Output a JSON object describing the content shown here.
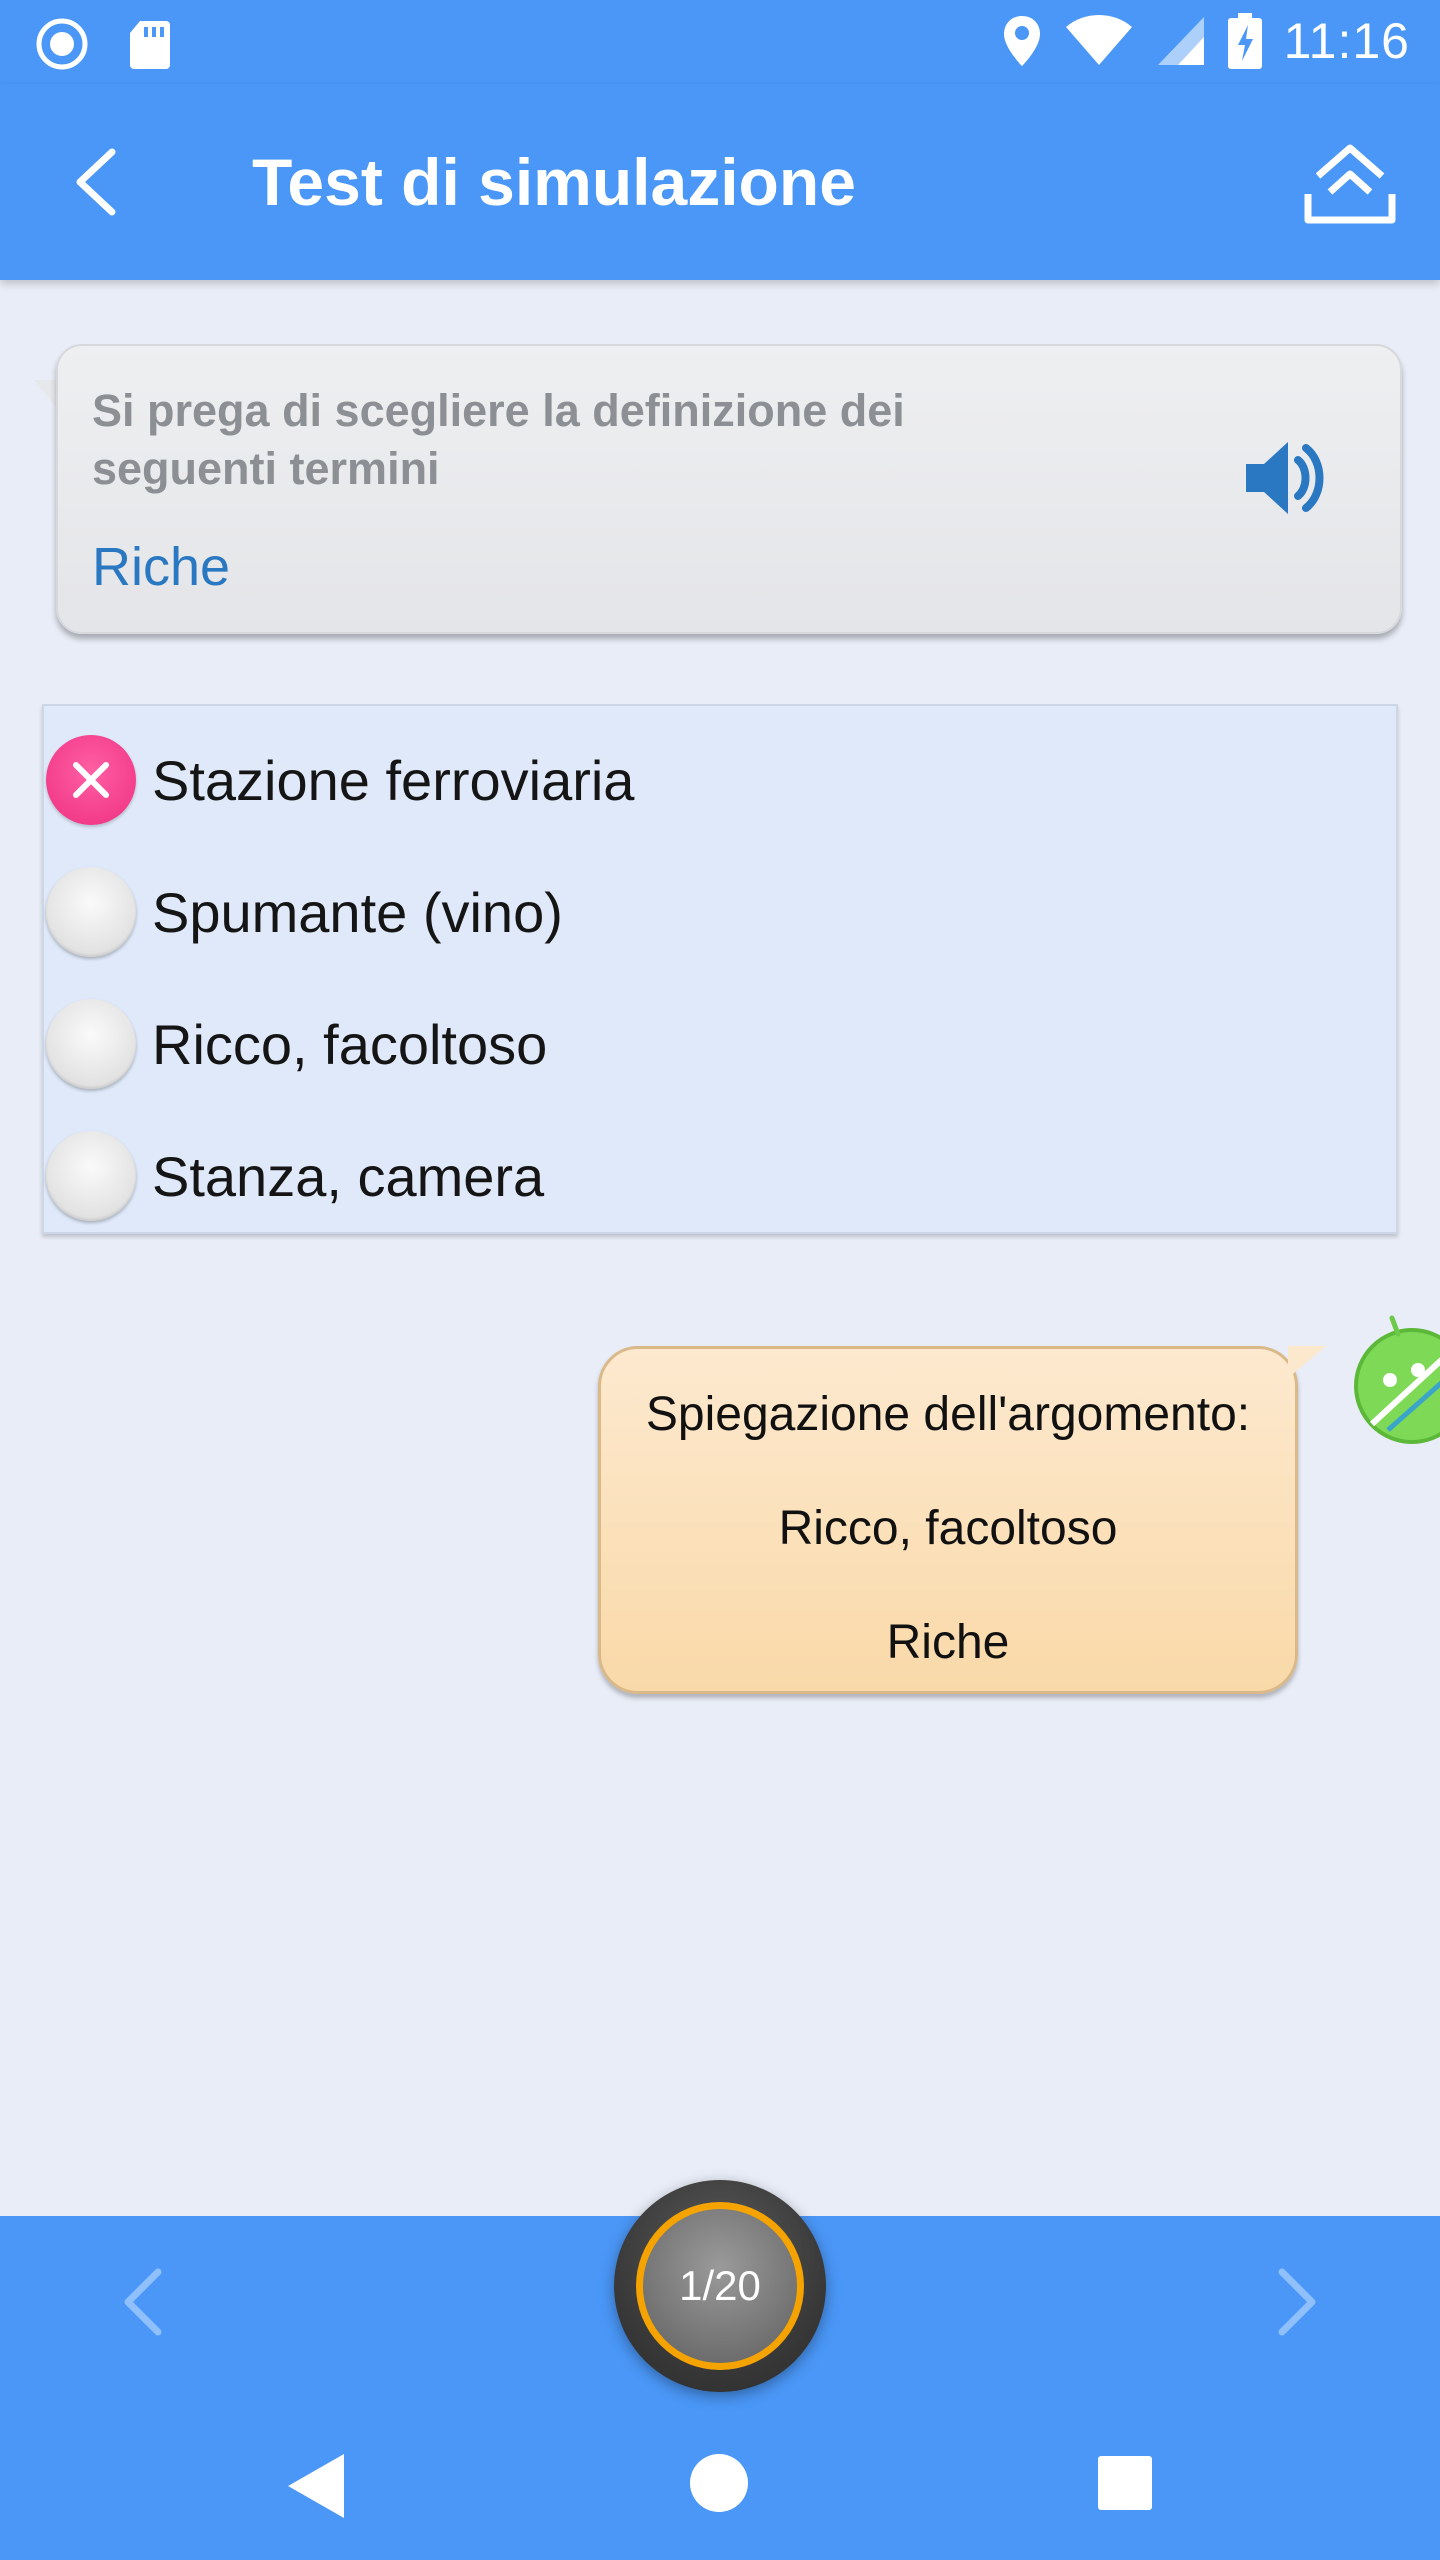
{
  "status_bar": {
    "time": "11:16",
    "icons": [
      "record-icon",
      "sd-card-icon",
      "location-icon",
      "wifi-icon",
      "signal-icon",
      "battery-icon"
    ]
  },
  "app_bar": {
    "title": "Test di simulazione"
  },
  "question": {
    "prompt": "Si prega di scegliere la definizione dei seguenti termini",
    "term": "Riche"
  },
  "options": [
    {
      "label": "Stazione ferroviaria",
      "state": "wrong"
    },
    {
      "label": "Spumante (vino)",
      "state": "unselected"
    },
    {
      "label": "Ricco, facoltoso",
      "state": "unselected"
    },
    {
      "label": "Stanza, camera",
      "state": "unselected"
    }
  ],
  "explanation": {
    "heading": "Spiegazione dell'argomento:",
    "answer": "Ricco, facoltoso",
    "term": "Riche"
  },
  "pager": {
    "counter": "1/20"
  },
  "colors": {
    "primary": "#4a97f7",
    "background": "#e9edf7",
    "wrong": "#ee2f80",
    "accent_ring": "#f5a300",
    "term_blue": "#2a78c2"
  }
}
